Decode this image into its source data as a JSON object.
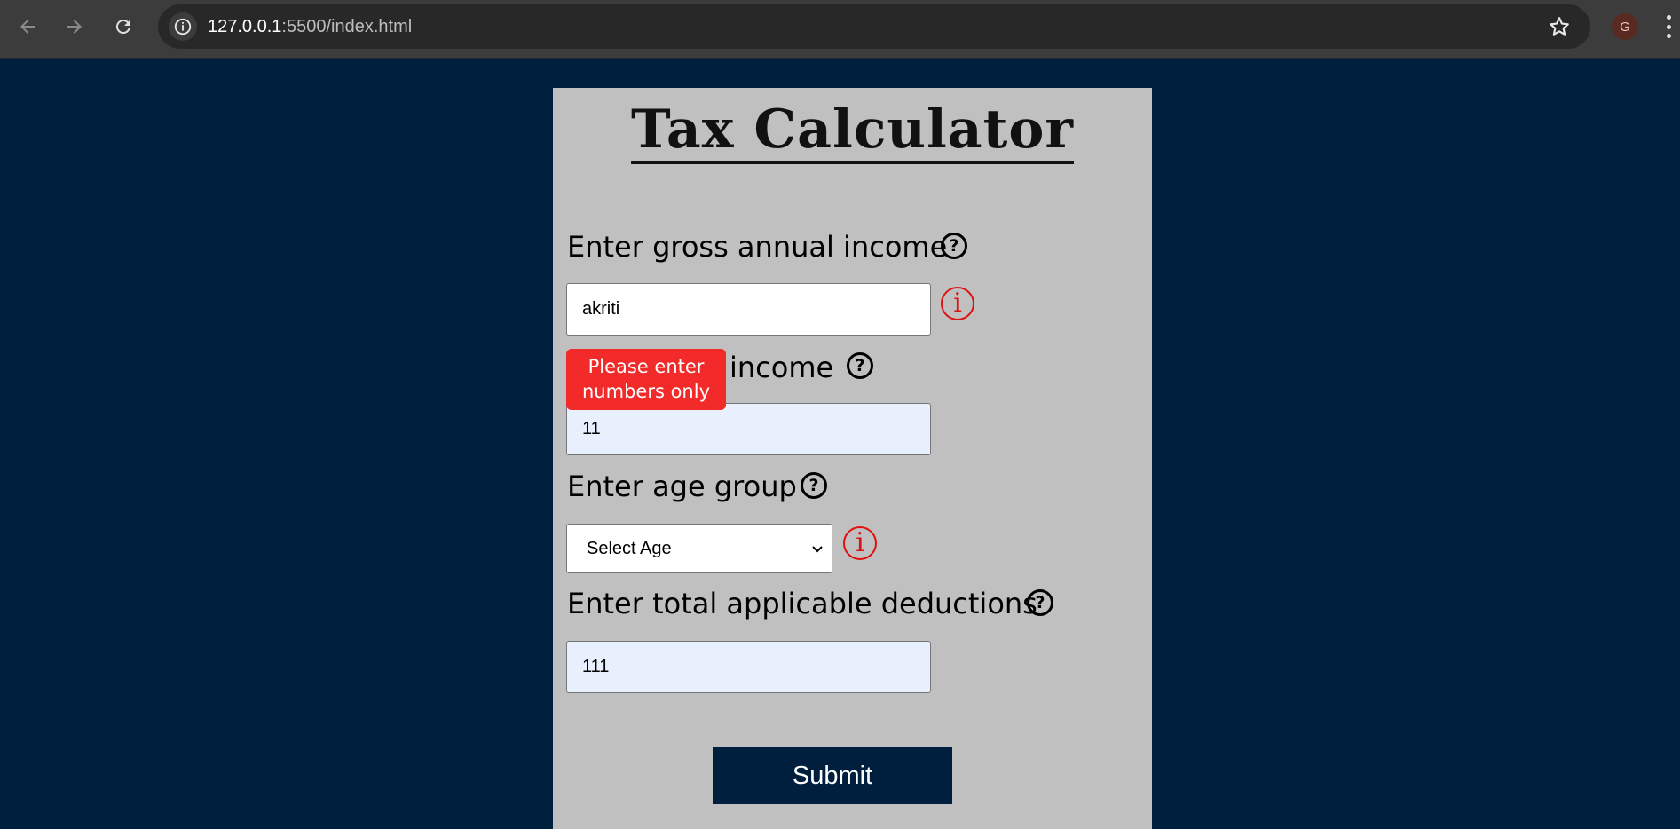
{
  "browser": {
    "url_host": "127.0.0.1",
    "url_path": ":5500/index.html",
    "profile_initial": "G",
    "icons": [
      "back-icon",
      "forward-icon",
      "reload-icon",
      "site-info-icon",
      "bookmark-star-icon",
      "menu-icon"
    ]
  },
  "page": {
    "title": "Tax Calculator",
    "fields": {
      "gross_income": {
        "label": "Enter gross annual income",
        "value": "akriti",
        "help_icon": "?",
        "error_icon": "i"
      },
      "extra_income": {
        "label": "Enter extra income",
        "visible_label": "income",
        "value": "11",
        "help_icon": "?"
      },
      "age_group": {
        "label": "Enter age group",
        "selected": "Select Age",
        "help_icon": "?",
        "error_icon": "i"
      },
      "deductions": {
        "label": "Enter total applicable deductions",
        "value": "111",
        "help_icon": "?"
      }
    },
    "tooltip": {
      "line1": "Please enter",
      "line2": "numbers only"
    },
    "submit_label": "Submit"
  },
  "colors": {
    "page_bg": "#001f3f",
    "card_bg": "#c0c0c0",
    "error": "#e01010",
    "tooltip_bg": "#f32a2a",
    "autofill_bg": "#e8f0fe",
    "button_bg": "#001f3f"
  }
}
